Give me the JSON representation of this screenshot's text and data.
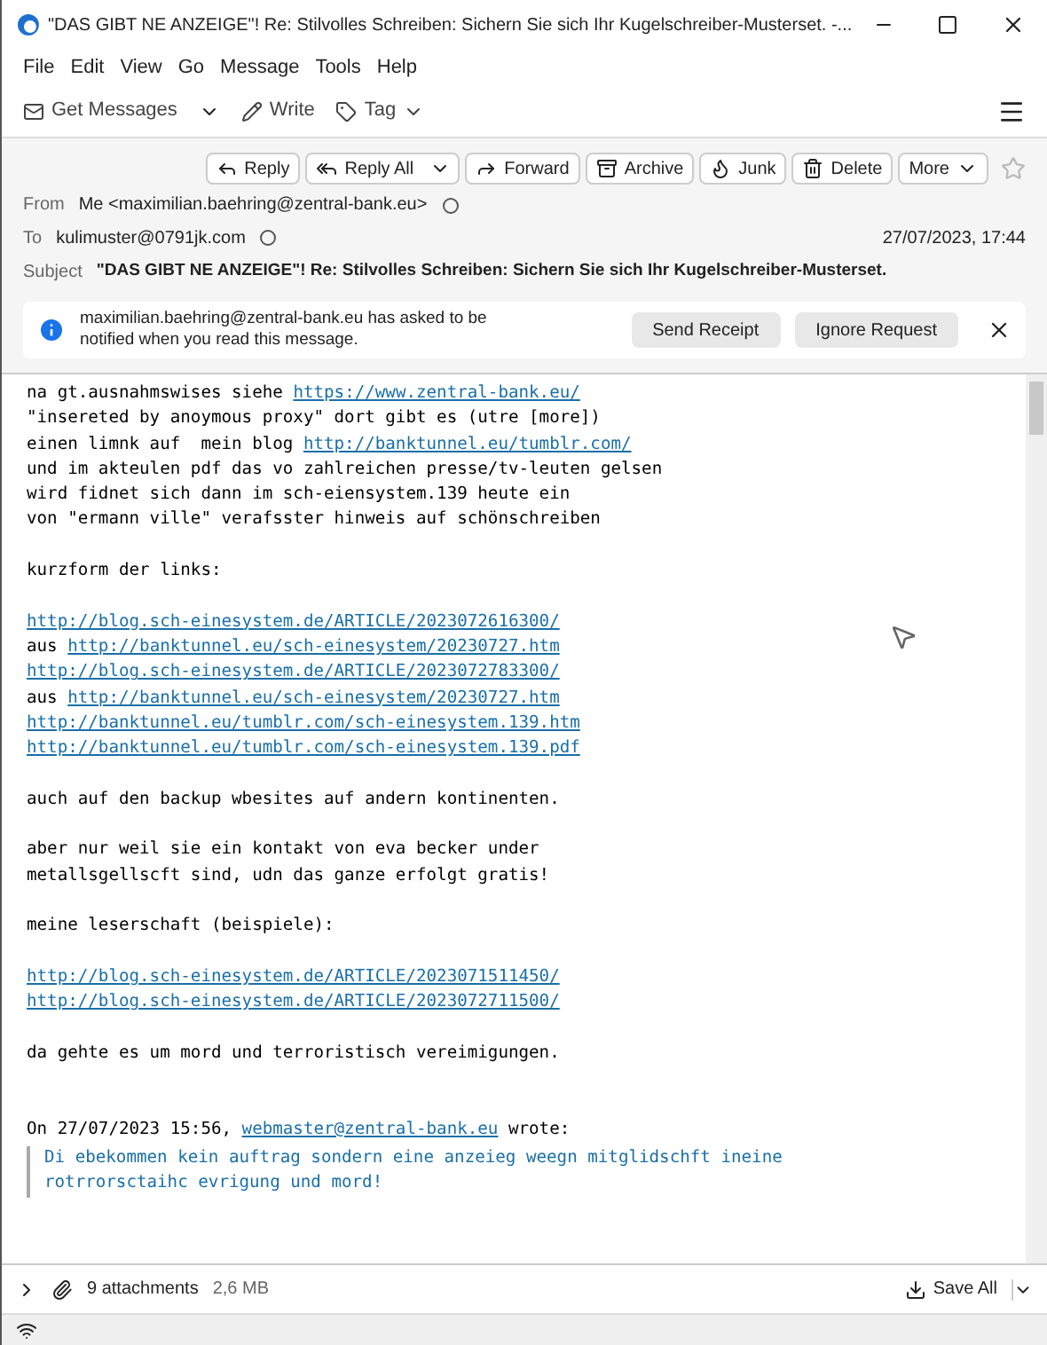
{
  "window": {
    "title": "\"DAS GIBT NE ANZEIGE\"! Re: Stilvolles Schreiben: Sichern Sie sich Ihr Kugelschreiber-Musterset. -..."
  },
  "menu": [
    "File",
    "Edit",
    "View",
    "Go",
    "Message",
    "Tools",
    "Help"
  ],
  "toolbar": [
    {
      "label": "Get Messages",
      "kind": "split"
    },
    {
      "label": "Write",
      "kind": "plain"
    },
    {
      "label": "Tag",
      "kind": "dropdown"
    }
  ],
  "actions": [
    {
      "label": "Reply",
      "kind": "plain"
    },
    {
      "label": "Reply All",
      "kind": "split"
    },
    {
      "label": "Forward",
      "kind": "plain"
    },
    {
      "label": "Archive",
      "kind": "plain"
    },
    {
      "label": "Junk",
      "kind": "plain"
    },
    {
      "label": "Delete",
      "kind": "plain"
    },
    {
      "label": "More",
      "kind": "dropdown"
    }
  ],
  "header": {
    "from_label": "From",
    "from": "Me <maximilian.baehring@zentral-bank.eu>",
    "to_label": "To",
    "to": "kulimuster@0791jk.com",
    "date": "27/07/2023, 17:44",
    "subject_label": "Subject",
    "subject": "\"DAS GIBT NE ANZEIGE\"! Re: Stilvolles Schreiben: Sichern Sie sich Ihr Kugelschreiber-Musterset."
  },
  "notification": {
    "text": "maximilian.baehring@zentral-bank.eu has asked to be notified when you read this message.",
    "buttons": [
      "Send Receipt",
      "Ignore Request"
    ]
  },
  "body": [
    {
      "kind": "line",
      "segments": [
        {
          "text": "na gt.ausnahmswises siehe ",
          "link": false
        },
        {
          "text": "https://www.zentral-bank.eu/",
          "link": true
        }
      ]
    },
    {
      "kind": "line",
      "segments": [
        {
          "text": "\"insereted by anoymous proxy\" dort gibt es (utre [more])",
          "link": false
        }
      ]
    },
    {
      "kind": "line",
      "segments": [
        {
          "text": "einen limnk auf  mein blog ",
          "link": false
        },
        {
          "text": "http://banktunnel.eu/tumblr.com/",
          "link": true
        }
      ]
    },
    {
      "kind": "line",
      "segments": [
        {
          "text": "und im akteulen pdf das vo zahlreichen presse/tv-leuten gelsen",
          "link": false
        }
      ]
    },
    {
      "kind": "line",
      "segments": [
        {
          "text": "wird fidnet sich dann im sch-eiensystem.139 heute ein",
          "link": false
        }
      ]
    },
    {
      "kind": "line",
      "segments": [
        {
          "text": "von \"ermann ville\" verafsster hinweis auf schönschreiben",
          "link": false
        }
      ]
    },
    {
      "kind": "blank"
    },
    {
      "kind": "line",
      "segments": [
        {
          "text": "kurzform der links:",
          "link": false
        }
      ]
    },
    {
      "kind": "blank"
    },
    {
      "kind": "line",
      "segments": [
        {
          "text": "http://blog.sch-einesystem.de/ARTICLE/2023072616300/",
          "link": true
        }
      ]
    },
    {
      "kind": "line",
      "segments": [
        {
          "text": "aus ",
          "link": false
        },
        {
          "text": "http://banktunnel.eu/sch-einesystem/20230727.htm",
          "link": true
        }
      ]
    },
    {
      "kind": "line",
      "segments": [
        {
          "text": "http://blog.sch-einesystem.de/ARTICLE/2023072783300/",
          "link": true
        }
      ]
    },
    {
      "kind": "line",
      "segments": [
        {
          "text": "aus ",
          "link": false
        },
        {
          "text": "http://banktunnel.eu/sch-einesystem/20230727.htm",
          "link": true
        }
      ]
    },
    {
      "kind": "line",
      "segments": [
        {
          "text": "http://banktunnel.eu/tumblr.com/sch-einesystem.139.htm",
          "link": true
        }
      ]
    },
    {
      "kind": "line",
      "segments": [
        {
          "text": "http://banktunnel.eu/tumblr.com/sch-einesystem.139.pdf",
          "link": true
        }
      ]
    },
    {
      "kind": "blank"
    },
    {
      "kind": "line",
      "segments": [
        {
          "text": "auch auf den backup wbesites auf andern kontinenten.",
          "link": false
        }
      ]
    },
    {
      "kind": "blank"
    },
    {
      "kind": "line",
      "segments": [
        {
          "text": "aber nur weil sie ein kontakt von eva becker under",
          "link": false
        }
      ]
    },
    {
      "kind": "line",
      "segments": [
        {
          "text": "metallsgellscft sind, udn das ganze erfolgt gratis!",
          "link": false
        }
      ]
    },
    {
      "kind": "blank"
    },
    {
      "kind": "line",
      "segments": [
        {
          "text": "meine leserschaft (beispiele):",
          "link": false
        }
      ]
    },
    {
      "kind": "blank"
    },
    {
      "kind": "line",
      "segments": [
        {
          "text": "http://blog.sch-einesystem.de/ARTICLE/2023071511450/",
          "link": true
        }
      ]
    },
    {
      "kind": "line",
      "segments": [
        {
          "text": "http://blog.sch-einesystem.de/ARTICLE/2023072711500/",
          "link": true
        }
      ]
    },
    {
      "kind": "blank"
    },
    {
      "kind": "line",
      "segments": [
        {
          "text": "da gehte es um mord und terroristisch vereimigungen.",
          "link": false
        }
      ]
    },
    {
      "kind": "blank"
    },
    {
      "kind": "blank"
    },
    {
      "kind": "line",
      "segments": [
        {
          "text": "On 27/07/2023 15:56, ",
          "link": false
        },
        {
          "text": "webmaster@zentral-bank.eu",
          "link": true
        },
        {
          "text": " wrote:",
          "link": false
        }
      ]
    },
    {
      "kind": "quote",
      "segments": [
        {
          "text": "Di ebekommen kein auftrag sondern eine anzeieg weegn mitglidschft ineine rotrrorsctaihc evrigung und mord!",
          "link": false
        }
      ]
    }
  ],
  "attachments": {
    "count": "9 attachments",
    "size": "2,6 MB",
    "save": "Save All"
  }
}
